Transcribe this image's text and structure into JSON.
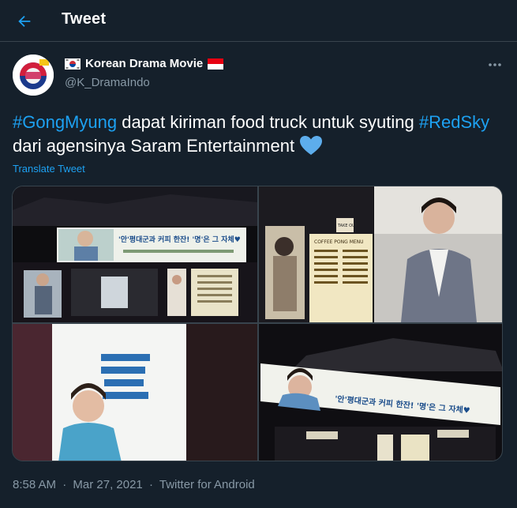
{
  "header": {
    "title": "Tweet",
    "back_icon": "arrow-left-icon"
  },
  "author": {
    "display_name": "Korean Drama Movie",
    "handle": "@K_DramaIndo",
    "flag_before": "south-korea-flag-icon",
    "flag_after": "indonesia-flag-icon"
  },
  "tweet": {
    "hashtag1": "#GongMyung",
    "text1": " dapat kiriman food truck untuk syuting ",
    "hashtag2": "#RedSky",
    "text2": " dari agensinya Saram Entertainment ",
    "emoji": "blue-heart-icon",
    "translate_label": "Translate Tweet"
  },
  "media": {
    "photo1": {
      "banner_line": "'안'평대군과 커피 한잔! '명'은 그 자체♥"
    },
    "photo2": {
      "menu_title": "COFFEE PONG MENU",
      "sign": "TAKE OUT"
    },
    "photo4": {
      "banner_line": "'안'평대군과 커피 한잔! '명'은 그 자체♥"
    }
  },
  "meta": {
    "time": "8:58 AM",
    "sep1": "·",
    "date": "Mar 27, 2021",
    "sep2": "·",
    "client": "Twitter for Android"
  },
  "colors": {
    "background": "#15202b",
    "accent": "#1da1f2",
    "muted": "#8899a6",
    "border": "#38444d"
  }
}
